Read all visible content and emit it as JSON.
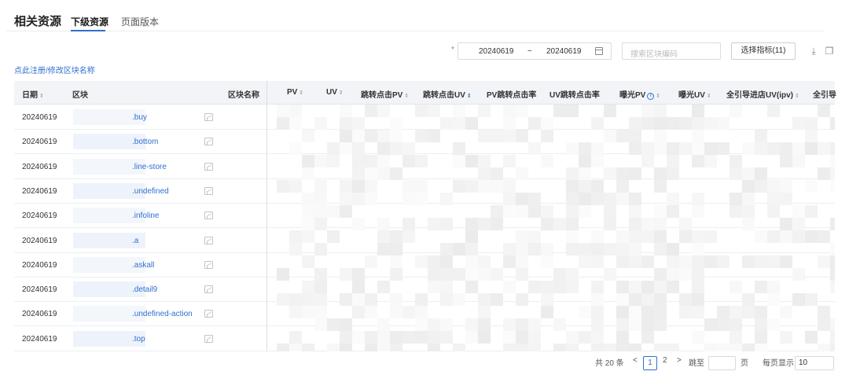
{
  "header": {
    "title": "相关资源",
    "tabs": [
      {
        "label": "下级资源",
        "active": true
      },
      {
        "label": "页面版本",
        "active": false
      }
    ]
  },
  "toolbar": {
    "required_mark": "*",
    "date_start": "20240619",
    "date_sep": "~",
    "date_end": "20240619",
    "search_placeholder": "搜索区块编码",
    "metric_button": "选择指标(11)",
    "icons": [
      "download-icon",
      "copy-icon"
    ]
  },
  "register_link": "点此注册/修改区块名称",
  "table": {
    "columns": [
      "日期",
      "区块",
      "区块名称",
      "PV",
      "UV",
      "跳转点击PV",
      "跳转点击UV",
      "PV跳转点击率",
      "UV跳转点击率",
      "曝光PV",
      "曝光UV",
      "全引导进店UV(ipv)",
      "全引导"
    ],
    "rows": [
      {
        "date": "20240619",
        "block": ".buy"
      },
      {
        "date": "20240619",
        "block": ".bottom"
      },
      {
        "date": "20240619",
        "block": ".line-store"
      },
      {
        "date": "20240619",
        "block": ".undefined"
      },
      {
        "date": "20240619",
        "block": ".infoline"
      },
      {
        "date": "20240619",
        "block": ".a"
      },
      {
        "date": "20240619",
        "block": ".askall"
      },
      {
        "date": "20240619",
        "block": ".detail9"
      },
      {
        "date": "20240619",
        "block": ".undefined-action"
      },
      {
        "date": "20240619",
        "block": ".top"
      }
    ]
  },
  "pagination": {
    "total": "共 20 条",
    "prev": "<",
    "pages": [
      "1",
      "2"
    ],
    "current": "1",
    "next": ">",
    "goto_label": "跳至",
    "goto_suffix": "页",
    "page_size_label": "每页显示",
    "page_size": "10"
  },
  "colors": {
    "accent": "#2f6fd1",
    "header_bg": "#f2f4f7"
  }
}
